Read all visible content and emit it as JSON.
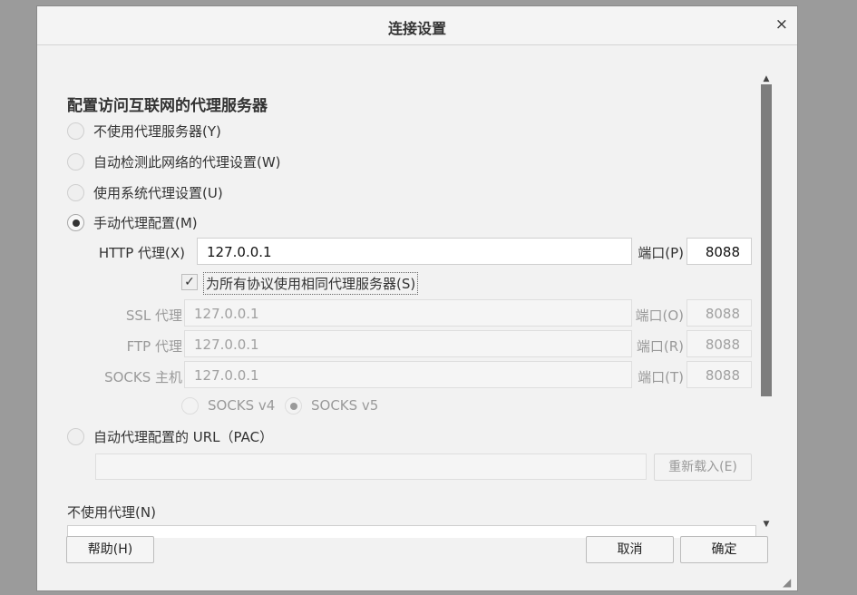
{
  "dialog": {
    "title": "连接设置",
    "close_glyph": "×"
  },
  "section": {
    "title": "配置访问互联网的代理服务器"
  },
  "options": [
    {
      "label": "不使用代理服务器(Y)",
      "checked": false
    },
    {
      "label": "自动检测此网络的代理设置(W)",
      "checked": false
    },
    {
      "label": "使用系统代理设置(U)",
      "checked": false
    },
    {
      "label": "手动代理配置(M)",
      "checked": true
    }
  ],
  "manual": {
    "http": {
      "label": "HTTP 代理(X)",
      "value": "127.0.0.1",
      "port_label": "端口(P)",
      "port": "8088"
    },
    "same_for_all": {
      "label": "为所有协议使用相同代理服务器(S)",
      "checked": true
    },
    "ssl": {
      "label": "SSL 代理",
      "value": "127.0.0.1",
      "port_label": "端口(O)",
      "port": "8088"
    },
    "ftp": {
      "label": "FTP 代理",
      "value": "127.0.0.1",
      "port_label": "端口(R)",
      "port": "8088"
    },
    "socks": {
      "label": "SOCKS 主机",
      "value": "127.0.0.1",
      "port_label": "端口(T)",
      "port": "8088"
    },
    "socks_v4": "SOCKS v4",
    "socks_v5": "SOCKS v5"
  },
  "pac": {
    "label": "自动代理配置的 URL（PAC）",
    "value": "",
    "reload_label": "重新载入(E)"
  },
  "no_proxy": {
    "label": "不使用代理(N)",
    "value": ""
  },
  "buttons": {
    "help": "帮助(H)",
    "cancel": "取消",
    "ok": "确定"
  },
  "colors": {
    "dialog_bg": "#f2f2f2",
    "backdrop": "#9b9b9b",
    "scroll_thumb": "#7d7d7d"
  }
}
